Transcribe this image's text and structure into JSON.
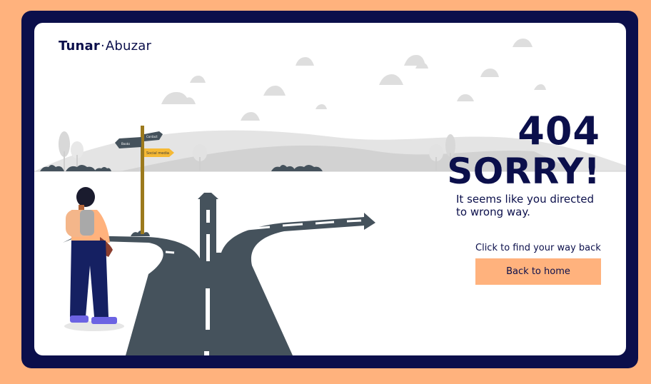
{
  "brand": {
    "name_bold": "Tunar",
    "separator": "·",
    "name_light": "Abuzar"
  },
  "error": {
    "code": "404",
    "headline": "SORRY!",
    "message_line1": "It seems like you directed",
    "message_line2": "to wrong way."
  },
  "cta": {
    "hint": "Click to find your way back",
    "button_label": "Back to home"
  },
  "signpost": {
    "sign1": "Books",
    "sign2": "Contact",
    "sign3": "Social media"
  },
  "colors": {
    "page_bg": "#ffb27d",
    "frame": "#0b0f4b",
    "text": "#0b0f4b",
    "button_bg": "#ffb27d",
    "road": "#45525c",
    "sign_yellow": "#f5b935"
  }
}
